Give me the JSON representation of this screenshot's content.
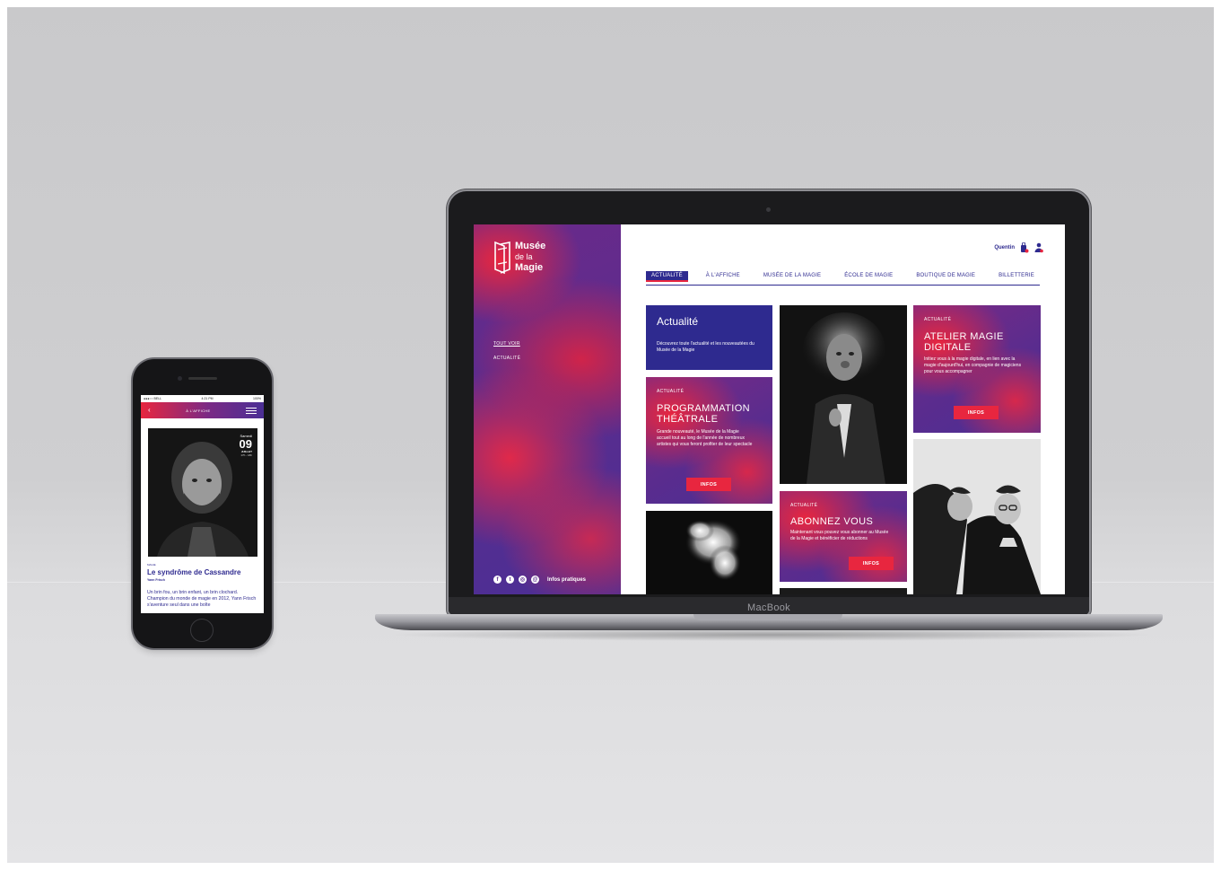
{
  "laptop": {
    "brand": "MacBook",
    "site": {
      "logo": {
        "line1": "Musée",
        "line2": "de la",
        "line3": "Magie"
      },
      "sidebar_links": [
        "TOUT VOIR",
        "ACTUALITÉ"
      ],
      "footer": {
        "icons": [
          "facebook-icon",
          "twitter-icon",
          "instagram-icon",
          "email-icon"
        ],
        "info_label": "Infos pratiques"
      },
      "user": {
        "name": "Quentin"
      },
      "nav": [
        "ACTUALITÉ",
        "À L'AFFICHE",
        "MUSÉE DE LA MAGIE",
        "ÉCOLE DE MAGIE",
        "BOUTIQUE DE MAGIE",
        "BILLETTERIE"
      ],
      "nav_active": "ACTUALITÉ",
      "cards": {
        "actualite": {
          "title": "Actualité",
          "text": "Découvrez toute l'actualité et les nouveautées du Musée de la Magie"
        },
        "programmation": {
          "tag": "ACTUALITÉ",
          "title_line1": "PROGRAMMATION",
          "title_line2": "THÉÂTRALE",
          "text": "Grande nouveauté, le Musée de la Magie accueil tout au long de l'année de nombreux artistes qui vous feront profiter de leur spectacle",
          "button": "INFOS"
        },
        "atelier": {
          "tag": "ACTUALITÉ",
          "title_line1": "ATELIER MAGIE",
          "title_line2": "DIGITALE",
          "text": "Initiez vous à la magie digitale, en lien avec la magie d'aujourd'hui, en compagnie de magiciens pour vous accompagner",
          "button": "INFOS"
        },
        "abonnez": {
          "tag": "ACTUALITÉ",
          "title": "ABONNEZ VOUS",
          "text": "Maintenant vous pouvez vous abonner au Musée de la Magie et bénéficier de réductions",
          "button": "INFOS"
        }
      }
    }
  },
  "phone": {
    "status": {
      "carrier": "●●●○○ BELL",
      "time": "4:21 PM",
      "battery": "100%"
    },
    "header_title": "À L'AFFICHE",
    "date": {
      "day_name": "Samedi",
      "day": "09",
      "month": "JUILLET",
      "hours": "17h - 18h"
    },
    "category": "MAGIE",
    "title": "Le syndrôme de Cassandre",
    "author": "Yann Frisch",
    "text": "Un brin fou, un brin enfant, un brin clochard. Champion du monde de magie en 2012, Yann Frisch s'aventure seul dans une boîte"
  },
  "colors": {
    "navy": "#2e2a8f",
    "red": "#e8263f",
    "purple": "#5a2c8e"
  }
}
